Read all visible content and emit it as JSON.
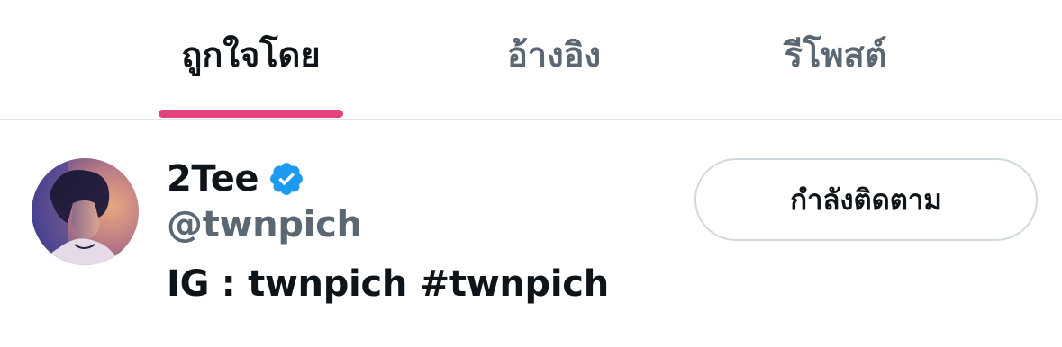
{
  "tabs": [
    {
      "label": "ถูกใจโดย",
      "active": true
    },
    {
      "label": "อ้างอิง",
      "active": false
    },
    {
      "label": "รีโพสต์",
      "active": false
    }
  ],
  "accent_color": "#e4417f",
  "verified_color": "#1d9bf0",
  "user": {
    "display_name": "2Tee",
    "handle": "@twnpich",
    "bio": "IG : twnpich #twnpich",
    "verified": true,
    "follow_button_label": "กำลังติดตาม"
  },
  "icons": {
    "verified": "verified-badge-icon",
    "avatar": "user-avatar-image"
  }
}
